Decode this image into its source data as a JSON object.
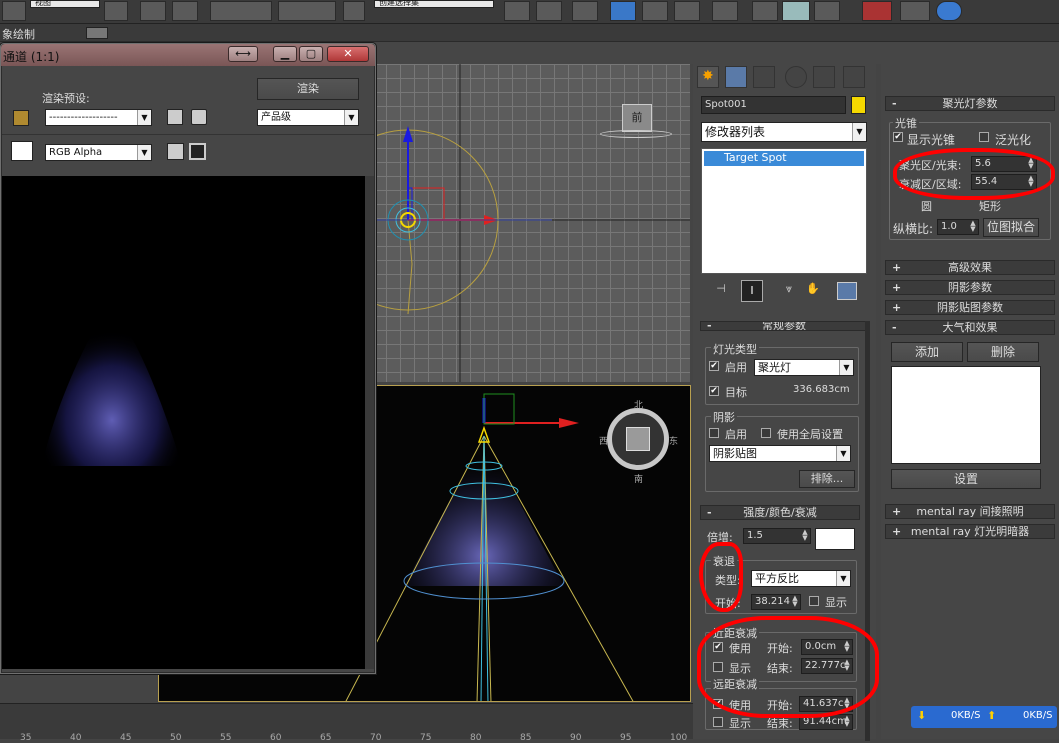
{
  "toolbar": {
    "view_select": "视图",
    "search": "创建选择集"
  },
  "menubar": {
    "label": "象绘制"
  },
  "render_window": {
    "title": "通道 (1:1)",
    "render_preset_label": "渲染预设:",
    "render_preset_value": "-------------------",
    "render_button": "渲染",
    "quality_value": "产品级",
    "channel_value": "RGB Alpha"
  },
  "viewport_top": {
    "label": "前"
  },
  "viewport_bottom": {
    "compass": {
      "top": "北",
      "bottom": "南",
      "left": "西",
      "right": "东"
    }
  },
  "ruler": {
    "ticks": [
      "35",
      "40",
      "45",
      "50",
      "55",
      "60",
      "65",
      "70",
      "75",
      "80",
      "85",
      "90",
      "95",
      "100"
    ]
  },
  "command_panel": {
    "object_name": "Spot001",
    "object_color": "#f5d800",
    "modifier_list": "修改器列表",
    "stack_items": [
      "Target Spot"
    ],
    "rollouts": {
      "general": {
        "header": "常规参数",
        "light_type_group": "灯光类型",
        "enable_label": "启用",
        "light_type_value": "聚光灯",
        "target_label": "目标",
        "target_distance": "336.683cm",
        "shadow_group": "阴影",
        "shadow_enable_label": "启用",
        "use_global_label": "使用全局设置",
        "shadow_type_value": "阴影贴图",
        "exclude_button": "排除..."
      },
      "intensity": {
        "header": "强度/颜色/衰减",
        "multiplier_label": "倍增:",
        "multiplier_value": "1.5",
        "light_color": "#ffffff",
        "decay_group": "衰退",
        "type_label": "类型:",
        "type_value": "平方反比",
        "start_label": "开始:",
        "start_value": "38.214",
        "show_label": "显示",
        "near_group": "近距衰减",
        "near_use_label": "使用",
        "near_start_label": "开始:",
        "near_start_value": "0.0cm",
        "near_show_label": "显示",
        "near_end_label": "结束:",
        "near_end_value": "22.777c",
        "far_group": "远距衰减",
        "far_use_label": "使用",
        "far_start_label": "开始:",
        "far_start_value": "41.637c",
        "far_show_label": "显示",
        "far_end_label": "结束:",
        "far_end_value": "91.44cm"
      }
    }
  },
  "spot_panel": {
    "header": "聚光灯参数",
    "cone_group": "光锥",
    "show_cone_label": "显示光锥",
    "overshoot_label": "泛光化",
    "hotspot_label": "聚光区/光束:",
    "hotspot_value": "5.6",
    "falloff_label": "衰减区/区域:",
    "falloff_value": "55.4",
    "circle_label": "圆",
    "rect_label": "矩形",
    "aspect_label": "纵横比:",
    "aspect_value": "1.0",
    "bitmap_fit_button": "位图拟合",
    "collapsed": [
      "高级效果",
      "阴影参数",
      "阴影贴图参数"
    ],
    "atmos_header": "大气和效果",
    "add_button": "添加",
    "delete_button": "删除",
    "setup_button": "设置",
    "mr_items": [
      "mental ray 间接照明",
      "mental ray 灯光明暗器"
    ]
  },
  "net_status": {
    "down": "0KB/S",
    "up": "0KB/S"
  }
}
